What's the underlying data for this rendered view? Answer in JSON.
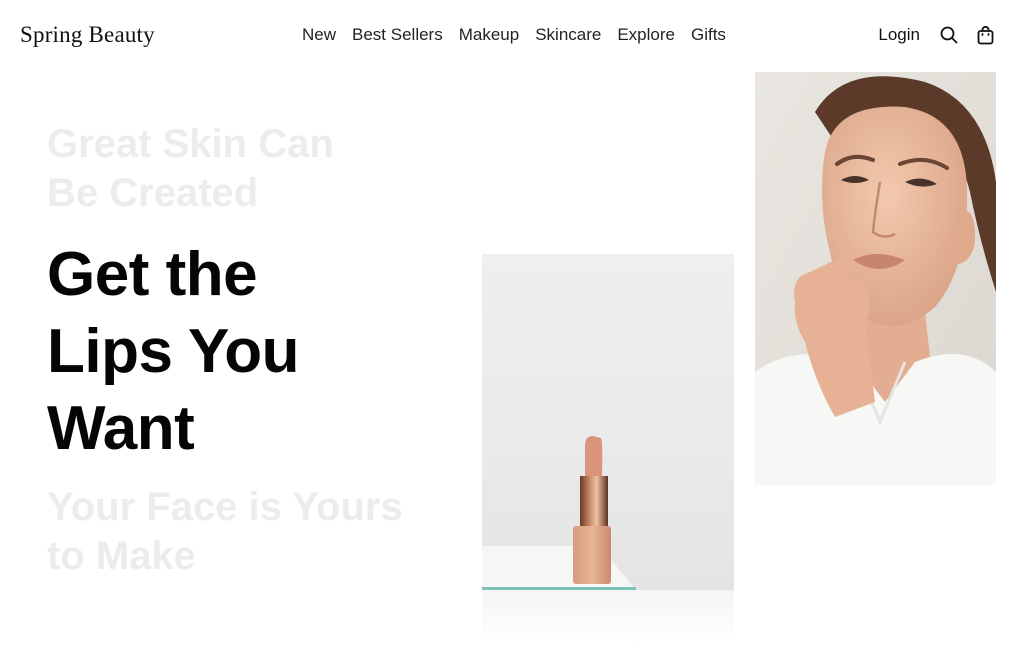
{
  "header": {
    "brand": "Spring Beauty",
    "nav": [
      "New",
      "Best Sellers",
      "Makeup",
      "Skincare",
      "Explore",
      "Gifts"
    ],
    "login_label": "Login",
    "icons": [
      "search-icon",
      "shopping-bag-icon"
    ]
  },
  "hero": {
    "faded_top_line1": "Great Skin Can",
    "faded_top_line2": "Be Created",
    "title_line1": "Get the",
    "title_line2": "Lips You",
    "title_line3": "Want",
    "faded_bottom_line1": "Your Face is Yours",
    "faded_bottom_line2": "to Make"
  },
  "colors": {
    "background": "#ffffff",
    "text": "#111111",
    "faded_text": "#ececec",
    "accent_glass": "#7cc3b6"
  }
}
